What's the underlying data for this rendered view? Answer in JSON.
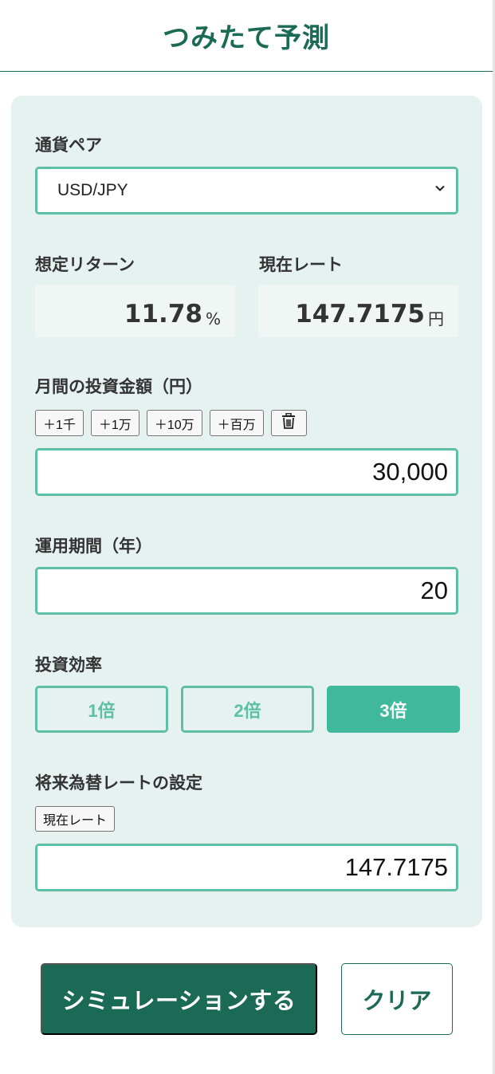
{
  "header": {
    "title": "つみたて予測"
  },
  "form": {
    "currency_pair": {
      "label": "通貨ペア",
      "value": "USD/JPY"
    },
    "expected_return": {
      "label": "想定リターン",
      "value": "11.78",
      "unit": "%"
    },
    "current_rate": {
      "label": "現在レート",
      "value": "147.7175",
      "unit": "円"
    },
    "monthly_investment": {
      "label": "月間の投資金額（円）",
      "quick_add": [
        "＋1千",
        "＋1万",
        "＋10万",
        "＋百万"
      ],
      "clear_icon": "trash-icon",
      "value": "30,000"
    },
    "period": {
      "label": "運用期間（年）",
      "value": "20"
    },
    "efficiency": {
      "label": "投資効率",
      "options": [
        "1倍",
        "2倍",
        "3倍"
      ],
      "selected": "3倍"
    },
    "future_rate": {
      "label": "将来為替レートの設定",
      "preset_button": "現在レート",
      "value": "147.7175"
    }
  },
  "actions": {
    "simulate": "シミュレーションする",
    "clear": "クリア"
  },
  "colors": {
    "brand_dark": "#1b6a55",
    "accent": "#5cbfa6",
    "active_fill": "#3fb89c",
    "panel_bg": "#e5f2ef"
  }
}
